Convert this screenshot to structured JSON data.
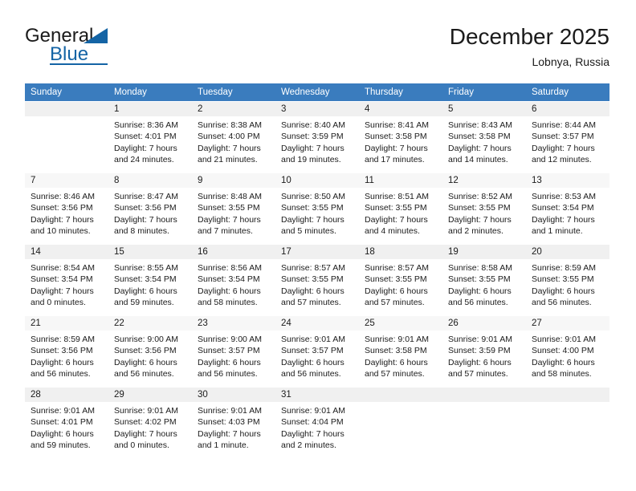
{
  "brand": {
    "word_one": "General",
    "word_two": "Blue",
    "logo_icon": "triangle-flag-icon"
  },
  "header": {
    "month_title": "December 2025",
    "location": "Lobnya, Russia"
  },
  "calendar": {
    "weekday_headers": [
      "Sunday",
      "Monday",
      "Tuesday",
      "Wednesday",
      "Thursday",
      "Friday",
      "Saturday"
    ],
    "labels": {
      "sunrise": "Sunrise:",
      "sunset": "Sunset:",
      "daylight": "Daylight:"
    },
    "weeks": [
      [
        {
          "day": "",
          "lines": []
        },
        {
          "day": "1",
          "lines": [
            "Sunrise: 8:36 AM",
            "Sunset: 4:01 PM",
            "Daylight: 7 hours",
            "and 24 minutes."
          ]
        },
        {
          "day": "2",
          "lines": [
            "Sunrise: 8:38 AM",
            "Sunset: 4:00 PM",
            "Daylight: 7 hours",
            "and 21 minutes."
          ]
        },
        {
          "day": "3",
          "lines": [
            "Sunrise: 8:40 AM",
            "Sunset: 3:59 PM",
            "Daylight: 7 hours",
            "and 19 minutes."
          ]
        },
        {
          "day": "4",
          "lines": [
            "Sunrise: 8:41 AM",
            "Sunset: 3:58 PM",
            "Daylight: 7 hours",
            "and 17 minutes."
          ]
        },
        {
          "day": "5",
          "lines": [
            "Sunrise: 8:43 AM",
            "Sunset: 3:58 PM",
            "Daylight: 7 hours",
            "and 14 minutes."
          ]
        },
        {
          "day": "6",
          "lines": [
            "Sunrise: 8:44 AM",
            "Sunset: 3:57 PM",
            "Daylight: 7 hours",
            "and 12 minutes."
          ]
        }
      ],
      [
        {
          "day": "7",
          "lines": [
            "Sunrise: 8:46 AM",
            "Sunset: 3:56 PM",
            "Daylight: 7 hours",
            "and 10 minutes."
          ]
        },
        {
          "day": "8",
          "lines": [
            "Sunrise: 8:47 AM",
            "Sunset: 3:56 PM",
            "Daylight: 7 hours",
            "and 8 minutes."
          ]
        },
        {
          "day": "9",
          "lines": [
            "Sunrise: 8:48 AM",
            "Sunset: 3:55 PM",
            "Daylight: 7 hours",
            "and 7 minutes."
          ]
        },
        {
          "day": "10",
          "lines": [
            "Sunrise: 8:50 AM",
            "Sunset: 3:55 PM",
            "Daylight: 7 hours",
            "and 5 minutes."
          ]
        },
        {
          "day": "11",
          "lines": [
            "Sunrise: 8:51 AM",
            "Sunset: 3:55 PM",
            "Daylight: 7 hours",
            "and 4 minutes."
          ]
        },
        {
          "day": "12",
          "lines": [
            "Sunrise: 8:52 AM",
            "Sunset: 3:55 PM",
            "Daylight: 7 hours",
            "and 2 minutes."
          ]
        },
        {
          "day": "13",
          "lines": [
            "Sunrise: 8:53 AM",
            "Sunset: 3:54 PM",
            "Daylight: 7 hours",
            "and 1 minute."
          ]
        }
      ],
      [
        {
          "day": "14",
          "lines": [
            "Sunrise: 8:54 AM",
            "Sunset: 3:54 PM",
            "Daylight: 7 hours",
            "and 0 minutes."
          ]
        },
        {
          "day": "15",
          "lines": [
            "Sunrise: 8:55 AM",
            "Sunset: 3:54 PM",
            "Daylight: 6 hours",
            "and 59 minutes."
          ]
        },
        {
          "day": "16",
          "lines": [
            "Sunrise: 8:56 AM",
            "Sunset: 3:54 PM",
            "Daylight: 6 hours",
            "and 58 minutes."
          ]
        },
        {
          "day": "17",
          "lines": [
            "Sunrise: 8:57 AM",
            "Sunset: 3:55 PM",
            "Daylight: 6 hours",
            "and 57 minutes."
          ]
        },
        {
          "day": "18",
          "lines": [
            "Sunrise: 8:57 AM",
            "Sunset: 3:55 PM",
            "Daylight: 6 hours",
            "and 57 minutes."
          ]
        },
        {
          "day": "19",
          "lines": [
            "Sunrise: 8:58 AM",
            "Sunset: 3:55 PM",
            "Daylight: 6 hours",
            "and 56 minutes."
          ]
        },
        {
          "day": "20",
          "lines": [
            "Sunrise: 8:59 AM",
            "Sunset: 3:55 PM",
            "Daylight: 6 hours",
            "and 56 minutes."
          ]
        }
      ],
      [
        {
          "day": "21",
          "lines": [
            "Sunrise: 8:59 AM",
            "Sunset: 3:56 PM",
            "Daylight: 6 hours",
            "and 56 minutes."
          ]
        },
        {
          "day": "22",
          "lines": [
            "Sunrise: 9:00 AM",
            "Sunset: 3:56 PM",
            "Daylight: 6 hours",
            "and 56 minutes."
          ]
        },
        {
          "day": "23",
          "lines": [
            "Sunrise: 9:00 AM",
            "Sunset: 3:57 PM",
            "Daylight: 6 hours",
            "and 56 minutes."
          ]
        },
        {
          "day": "24",
          "lines": [
            "Sunrise: 9:01 AM",
            "Sunset: 3:57 PM",
            "Daylight: 6 hours",
            "and 56 minutes."
          ]
        },
        {
          "day": "25",
          "lines": [
            "Sunrise: 9:01 AM",
            "Sunset: 3:58 PM",
            "Daylight: 6 hours",
            "and 57 minutes."
          ]
        },
        {
          "day": "26",
          "lines": [
            "Sunrise: 9:01 AM",
            "Sunset: 3:59 PM",
            "Daylight: 6 hours",
            "and 57 minutes."
          ]
        },
        {
          "day": "27",
          "lines": [
            "Sunrise: 9:01 AM",
            "Sunset: 4:00 PM",
            "Daylight: 6 hours",
            "and 58 minutes."
          ]
        }
      ],
      [
        {
          "day": "28",
          "lines": [
            "Sunrise: 9:01 AM",
            "Sunset: 4:01 PM",
            "Daylight: 6 hours",
            "and 59 minutes."
          ]
        },
        {
          "day": "29",
          "lines": [
            "Sunrise: 9:01 AM",
            "Sunset: 4:02 PM",
            "Daylight: 7 hours",
            "and 0 minutes."
          ]
        },
        {
          "day": "30",
          "lines": [
            "Sunrise: 9:01 AM",
            "Sunset: 4:03 PM",
            "Daylight: 7 hours",
            "and 1 minute."
          ]
        },
        {
          "day": "31",
          "lines": [
            "Sunrise: 9:01 AM",
            "Sunset: 4:04 PM",
            "Daylight: 7 hours",
            "and 2 minutes."
          ]
        },
        {
          "day": "",
          "lines": []
        },
        {
          "day": "",
          "lines": []
        },
        {
          "day": "",
          "lines": []
        }
      ]
    ]
  },
  "colors": {
    "header_blue": "#3a7cbe",
    "brand_blue": "#1464a5",
    "day_shade": "#f0f0f0",
    "text": "#1b1b1b"
  }
}
